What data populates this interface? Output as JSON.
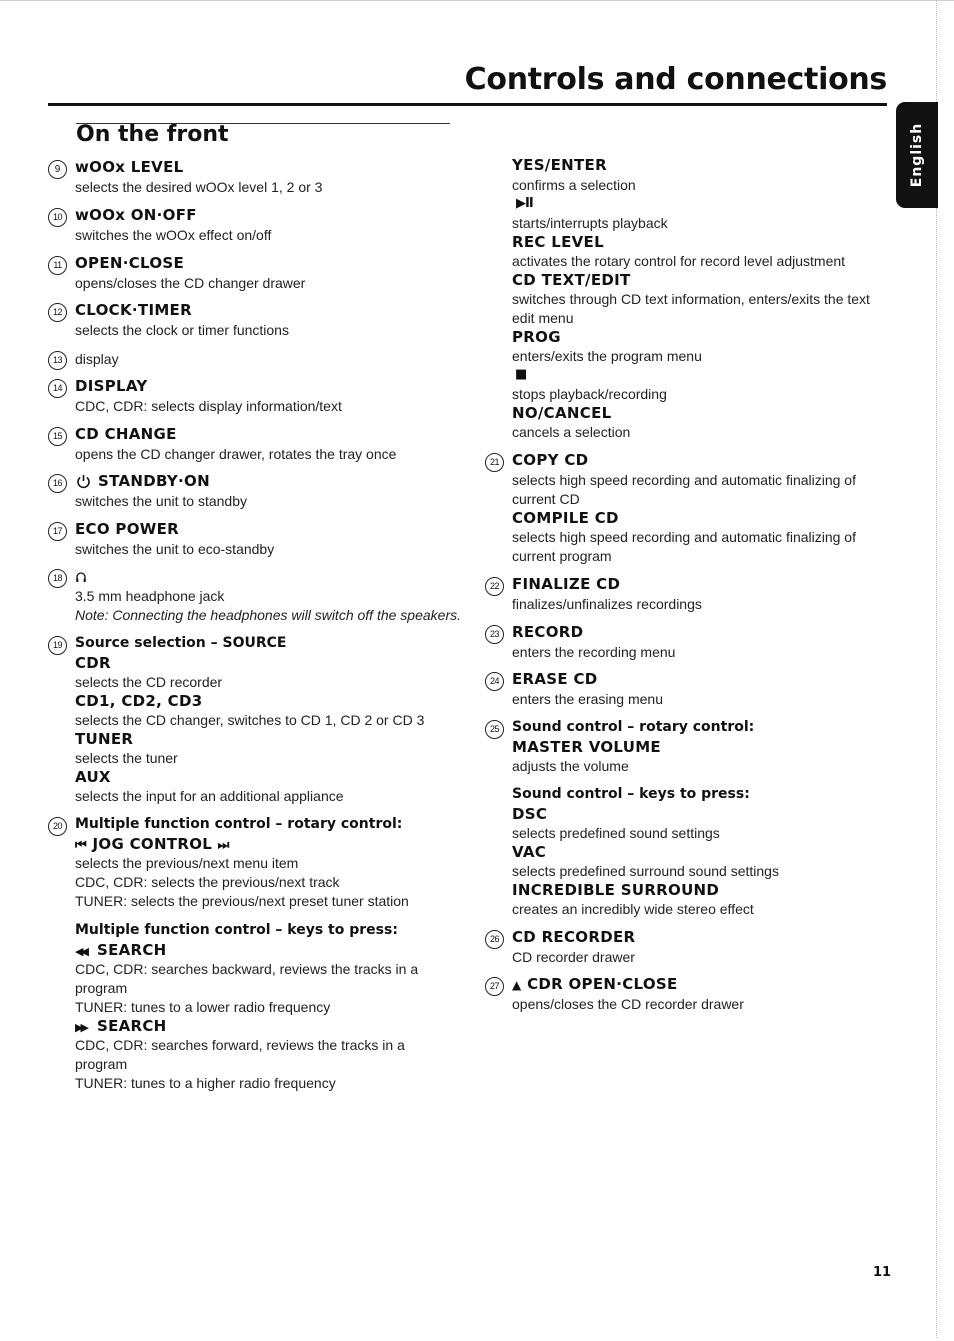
{
  "header": {
    "page_title": "Controls and connections",
    "section_title": "On the front",
    "language_tab": "English"
  },
  "left_column": {
    "item9": {
      "number": "9",
      "title": "wOOx LEVEL",
      "desc": "selects the desired wOOx level 1, 2 or 3"
    },
    "item10": {
      "number": "10",
      "title": "wOOx ON·OFF",
      "desc": "switches the wOOx effect on/off"
    },
    "item11": {
      "number": "11",
      "title": "OPEN·CLOSE",
      "desc": "opens/closes the CD changer drawer"
    },
    "item12": {
      "number": "12",
      "title": "CLOCK·TIMER",
      "desc": "selects the clock or timer functions"
    },
    "item13": {
      "number": "13",
      "desc": "display"
    },
    "item14": {
      "number": "14",
      "title": "DISPLAY",
      "desc": "CDC, CDR: selects display information/text"
    },
    "item15": {
      "number": "15",
      "title": "CD CHANGE",
      "desc": "opens the CD changer drawer, rotates the tray once"
    },
    "item16": {
      "number": "16",
      "icon": "power-icon",
      "title": "STANDBY·ON",
      "desc": "switches the unit to standby"
    },
    "item17": {
      "number": "17",
      "title": "ECO POWER",
      "desc": "switches the unit to eco-standby"
    },
    "item18": {
      "number": "18",
      "icon": "headphones-icon",
      "desc": "3.5 mm headphone jack",
      "note": "Note: Connecting the headphones will switch off the speakers."
    },
    "item19": {
      "number": "19",
      "title": "Source selection – SOURCE",
      "sub": [
        {
          "key": "CDR",
          "desc": "selects the CD recorder"
        },
        {
          "key": "CD1, CD2, CD3",
          "desc": "selects the CD changer, switches to CD 1, CD 2 or CD 3"
        },
        {
          "key": "TUNER",
          "desc": "selects the tuner"
        },
        {
          "key": "AUX",
          "desc": "selects the input for an additional appliance"
        }
      ]
    },
    "item20": {
      "number": "20",
      "title": "Multiple function control – rotary control:",
      "jog_left_symbol": "⏮",
      "jog_label": "JOG CONTROL",
      "jog_right_symbol": "⏭",
      "jog_desc": [
        "selects the previous/next menu item",
        "CDC, CDR: selects the previous/next track",
        "TUNER: selects the previous/next preset tuner station"
      ],
      "keys_title": "Multiple function control – keys to press:",
      "search_back_symbol": "◀◀",
      "search_back_label": "SEARCH",
      "search_back_desc": [
        "CDC, CDR: searches backward, reviews the tracks in a",
        "program",
        "TUNER: tunes to a lower radio frequency"
      ],
      "search_fwd_symbol": "▶▶",
      "search_fwd_label": "SEARCH",
      "search_fwd_desc": [
        "CDC, CDR: searches forward, reviews the tracks in a",
        "program",
        "TUNER: tunes to a higher radio frequency"
      ]
    }
  },
  "right_column": {
    "yes_enter": {
      "title": "YES/ENTER",
      "desc": "confirms a selection"
    },
    "play_pause": {
      "symbol": "▶II",
      "desc": "starts/interrupts playback"
    },
    "rec_level": {
      "title": "REC LEVEL",
      "desc": "activates the rotary control for record level adjustment"
    },
    "cd_text_edit": {
      "title": "CD TEXT/EDIT",
      "desc": [
        "switches through CD text information, enters/exits the text",
        "edit menu"
      ]
    },
    "prog": {
      "title": "PROG",
      "desc": "enters/exits the program menu"
    },
    "stop": {
      "symbol": "■",
      "desc": "stops playback/recording"
    },
    "no_cancel": {
      "title": "NO/CANCEL",
      "desc": "cancels a selection"
    },
    "item21": {
      "number": "21",
      "title": "COPY CD",
      "desc": [
        "selects high speed recording and automatic finalizing of",
        "current CD"
      ],
      "title2": "COMPILE CD",
      "desc2": [
        "selects high speed recording and automatic finalizing of",
        "current program"
      ]
    },
    "item22": {
      "number": "22",
      "title": "FINALIZE CD",
      "desc": "finalizes/unfinalizes recordings"
    },
    "item23": {
      "number": "23",
      "title": "RECORD",
      "desc": "enters the recording menu"
    },
    "item24": {
      "number": "24",
      "title": "ERASE CD",
      "desc": "enters the erasing menu"
    },
    "item25": {
      "number": "25",
      "title": "Sound control – rotary control:",
      "sub_title": "MASTER VOLUME",
      "sub_desc": "adjusts the volume",
      "keys_title": "Sound control – keys to press:",
      "keys": [
        {
          "key": "DSC",
          "desc": "selects predefined sound settings"
        },
        {
          "key": "VAC",
          "desc": "selects predefined surround sound settings"
        },
        {
          "key": "INCREDIBLE SURROUND",
          "desc": "creates an incredibly wide stereo effect"
        }
      ]
    },
    "item26": {
      "number": "26",
      "title": "CD RECORDER",
      "desc": "CD recorder drawer"
    },
    "item27": {
      "number": "27",
      "symbol": "▲",
      "title": "CDR OPEN·CLOSE",
      "desc": "opens/closes the CD recorder drawer"
    }
  },
  "footer": {
    "page_number": "11"
  }
}
